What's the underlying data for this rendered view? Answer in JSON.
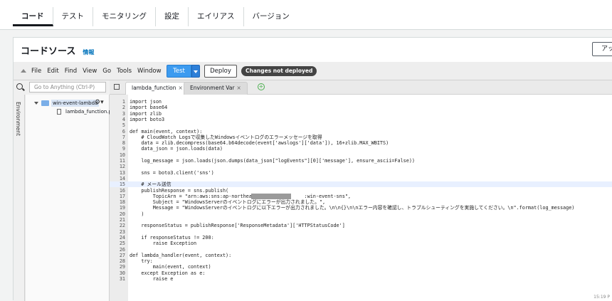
{
  "tabs": [
    "コード",
    "テスト",
    "モニタリング",
    "設定",
    "エイリアス",
    "バージョン"
  ],
  "header": {
    "title": "コードソース",
    "info": "情報",
    "right_button": "アッ"
  },
  "menus": [
    "File",
    "Edit",
    "Find",
    "View",
    "Go",
    "Tools",
    "Window"
  ],
  "toolbar": {
    "test": "Test",
    "deploy": "Deploy",
    "badge": "Changes not deployed"
  },
  "sidebar": {
    "strip_label": "Environment",
    "search_placeholder": "Go to Anything (Ctrl-P)",
    "folder": "win-event-lambda",
    "file": "lambda_function.py"
  },
  "editor_tabs": [
    "lambda_function",
    "Environment Var"
  ],
  "code_lines": [
    "import json",
    "import base64",
    "import zlib",
    "import boto3",
    "",
    "def main(event, context):",
    "    # CloudWatch Logsで収集したWindowsイベントログのエラーメッセージを取得",
    "    data = zlib.decompress(base64.b64decode(event['awslogs']['data']), 16+zlib.MAX_WBITS)",
    "    data_json = json.loads(data)",
    "",
    "    log_message = json.loads(json.dumps(data_json[\"logEvents\"][0]['message'], ensure_ascii=False))",
    "",
    "    sns = boto3.client('sns')",
    "",
    "    # メール送信",
    "    publishResponse = sns.publish(",
    "        TopicArn = \"arn:aws:sns:ap-northeast-1:             :win-event-sns\",",
    "        Subject = \"WindowsServerのイベントログにエラーが出力されました。\",",
    "        Message = \"WindowsServerのイベントログに以下エラーが出力されました。\\n\\n{}\\n\\nエラー内容を確認し、トラブルシューティングを実施してください。\\n\".format(log_message)",
    "    )",
    "",
    "    responseStatus = publishResponse['ResponseMetadata']['HTTPStatusCode']",
    "",
    "    if responseStatus != 200:",
    "        raise Exception",
    "",
    "def lambda_handler(event, context):",
    "    try:",
    "        main(event, context)",
    "    except Exception as e:",
    "        raise e"
  ],
  "status": "15:19 P"
}
